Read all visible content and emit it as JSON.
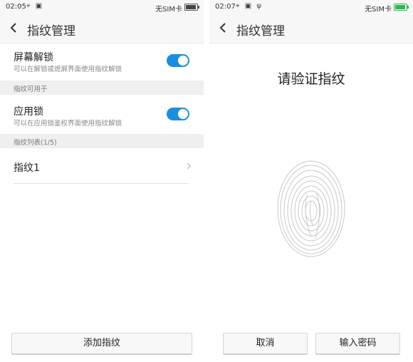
{
  "left": {
    "status": {
      "time": "02:05",
      "icons": "⌖ ▣",
      "carrier": "无SIM卡",
      "battery_level": 0.9
    },
    "header": {
      "title": "指纹管理"
    },
    "screen_unlock": {
      "title": "屏幕解锁",
      "subtitle": "可以在解锁或熄屏界面使用指纹解锁",
      "enabled": true
    },
    "section_usage": "指纹可用于",
    "app_lock": {
      "title": "应用锁",
      "subtitle": "可以在应用锁鉴权界面使用指纹解锁",
      "enabled": true
    },
    "section_list": "指纹列表(1/5)",
    "fingerprints": [
      "指纹1"
    ],
    "add_button": "添加指纹"
  },
  "right": {
    "status": {
      "time": "02:07",
      "icons": "⌖ ▣ ψ",
      "carrier": "无SIM卡",
      "battery_level": 0.9
    },
    "header": {
      "title": "指纹管理"
    },
    "verify_title": "请验证指纹",
    "cancel_button": "取消",
    "password_button": "输入密码"
  },
  "colors": {
    "toggle_on": "#198fe0",
    "battery_right": "#2db84d"
  }
}
